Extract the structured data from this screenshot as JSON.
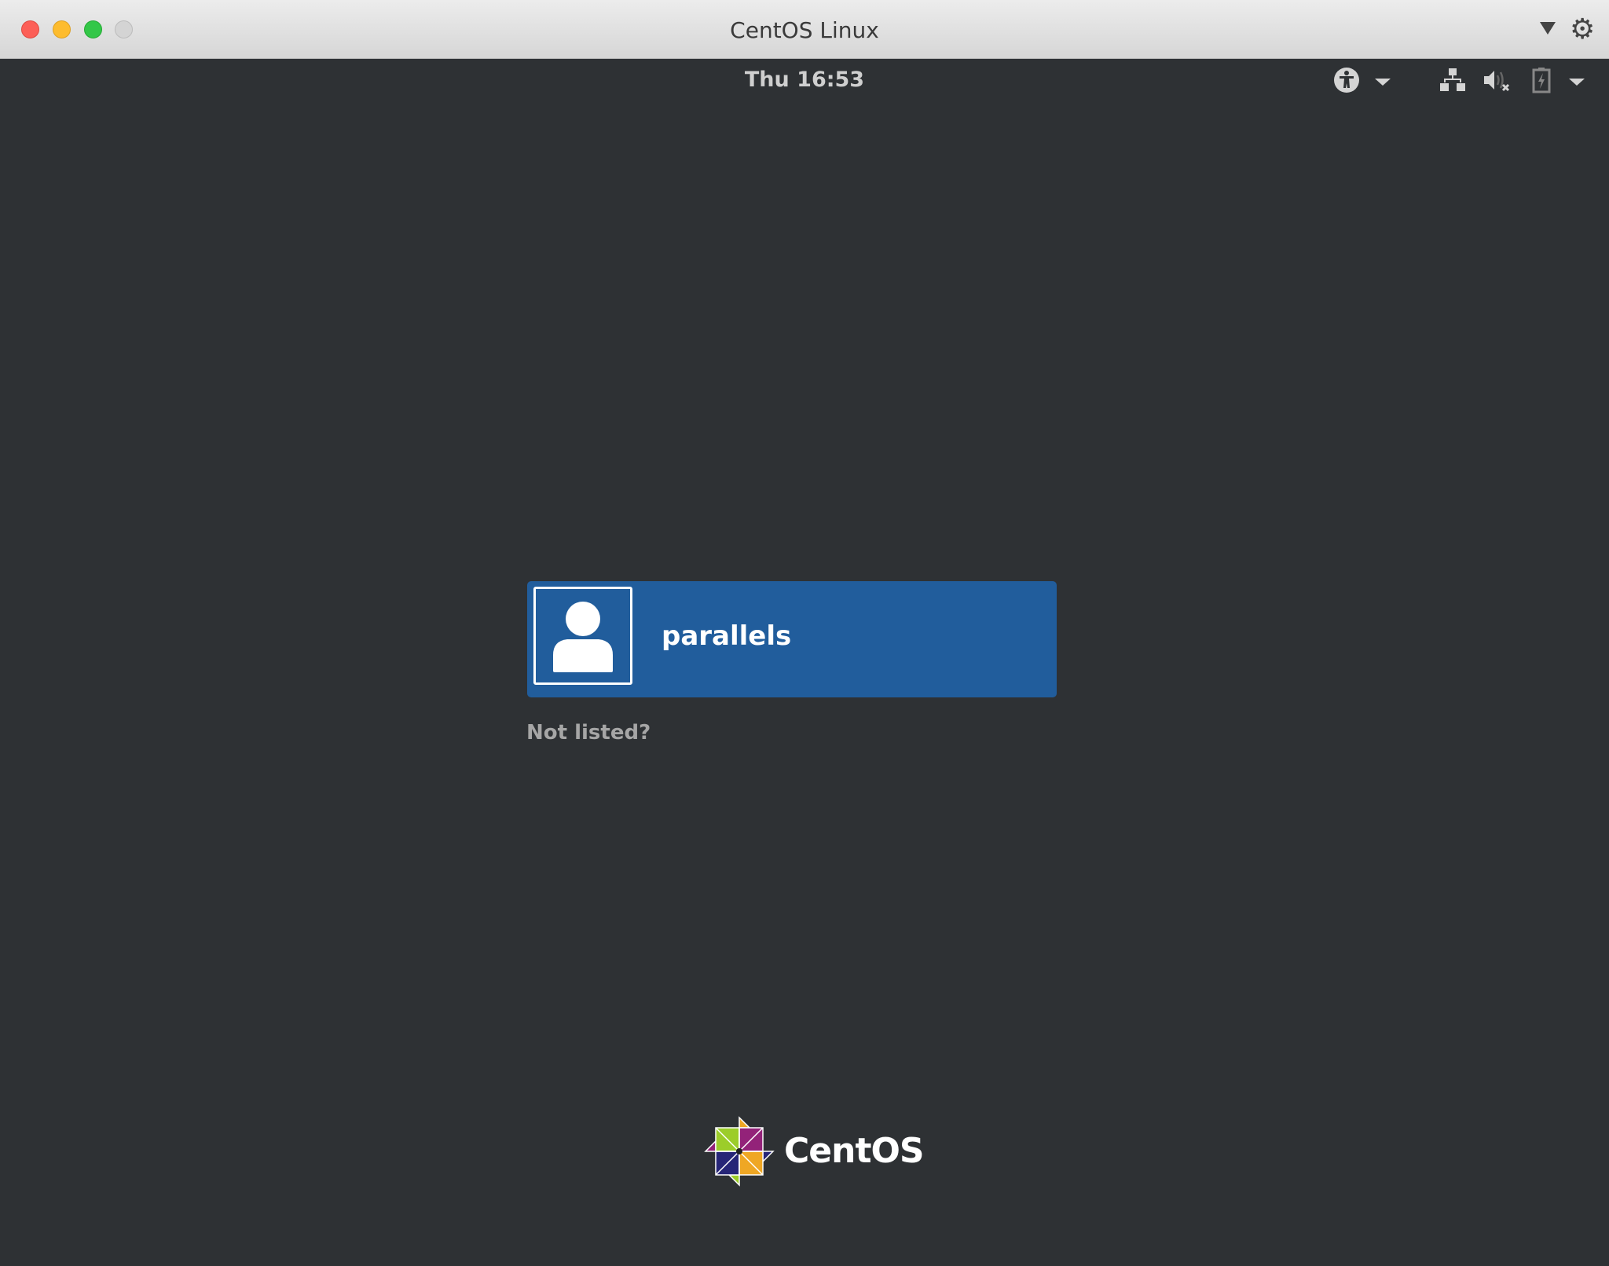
{
  "window": {
    "title": "CentOS Linux"
  },
  "topbar": {
    "clock": "Thu 16:53",
    "icons": [
      "accessibility-icon",
      "network-icon",
      "volume-muted-icon",
      "battery-charging-icon"
    ]
  },
  "login": {
    "users": [
      {
        "name": "parallels"
      }
    ],
    "not_listed": "Not listed?"
  },
  "branding": {
    "logo_text": "CentOS"
  },
  "colors": {
    "card": "#215d9c",
    "background": "#2e3134"
  }
}
